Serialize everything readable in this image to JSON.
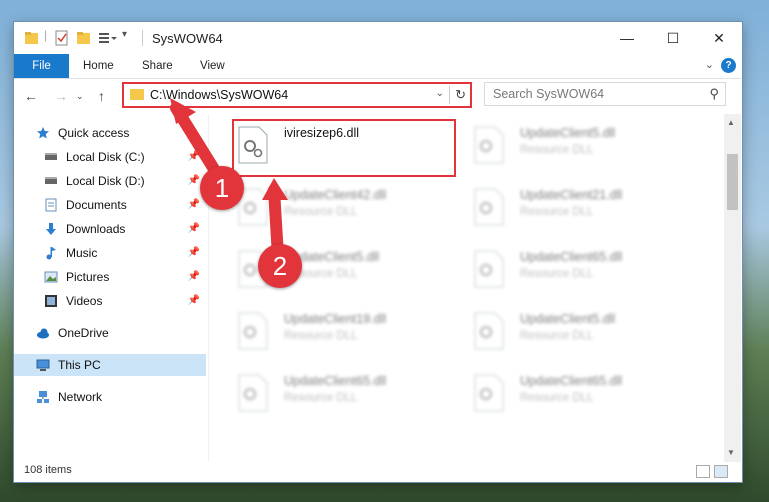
{
  "window": {
    "title": "SysWOW64",
    "controls": [
      "minimize-icon",
      "maximize-icon",
      "close-icon"
    ]
  },
  "ribbon": {
    "tabs": [
      "File",
      "Home",
      "Share",
      "View"
    ],
    "help_label": "?"
  },
  "navigation": {
    "address": "C:\\Windows\\SysWOW64",
    "search_placeholder": "Search SysWOW64"
  },
  "sidebar": {
    "items": [
      {
        "label": "Quick access",
        "icon": "star-icon",
        "pinned": false
      },
      {
        "label": "Local Disk (C:)",
        "icon": "drive-icon",
        "pinned": true
      },
      {
        "label": "Local Disk (D:)",
        "icon": "drive-icon",
        "pinned": true
      },
      {
        "label": "Documents",
        "icon": "documents-icon",
        "pinned": true
      },
      {
        "label": "Downloads",
        "icon": "download-icon",
        "pinned": true
      },
      {
        "label": "Music",
        "icon": "music-icon",
        "pinned": true
      },
      {
        "label": "Pictures",
        "icon": "pictures-icon",
        "pinned": true
      },
      {
        "label": "Videos",
        "icon": "videos-icon",
        "pinned": true
      },
      {
        "label": "OneDrive",
        "icon": "cloud-icon",
        "pinned": false
      },
      {
        "label": "This PC",
        "icon": "computer-icon",
        "pinned": false,
        "selected": true
      },
      {
        "label": "Network",
        "icon": "network-icon",
        "pinned": false
      }
    ]
  },
  "files": [
    {
      "name": "iviresizep6.dll",
      "type": "",
      "highlighted": true
    },
    {
      "name": "UpdateClient5.dll",
      "type": "Resource DLL"
    },
    {
      "name": "UpdateClient42.dll",
      "type": "Resource DLL"
    },
    {
      "name": "UpdateClient21.dll",
      "type": "Resource DLL"
    },
    {
      "name": "UpdateClient5.dll",
      "type": "Resource DLL"
    },
    {
      "name": "UpdateClient65.dll",
      "type": "Resource DLL"
    },
    {
      "name": "UpdateClient19.dll",
      "type": "Resource DLL"
    },
    {
      "name": "UpdateClient5.dll",
      "type": "Resource DLL"
    },
    {
      "name": "UpdateClient65.dll",
      "type": "Resource DLL"
    },
    {
      "name": "UpdateClient65.dll",
      "type": "Resource DLL"
    }
  ],
  "status": {
    "item_count": "108 items"
  },
  "annotations": {
    "step1": "1",
    "step2": "2",
    "color": "#e2353b"
  },
  "colors": {
    "accent": "#1979ca",
    "selection": "#cce4f7",
    "highlight": "#e2353b"
  }
}
